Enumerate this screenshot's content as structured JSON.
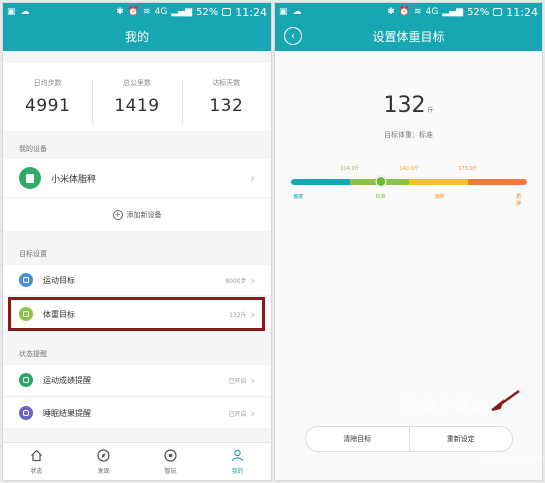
{
  "status_bar": {
    "battery": "52%",
    "time": "11:24",
    "network": "4G"
  },
  "left_screen": {
    "title": "我的",
    "stats": [
      {
        "label": "日均步数",
        "value": "4991"
      },
      {
        "label": "总公里数",
        "value": "1419"
      },
      {
        "label": "达标天数",
        "value": "132"
      }
    ],
    "devices_section": "我的设备",
    "device_name": "小米体脂秤",
    "add_device": "添加新设备",
    "goals_section": "目标设置",
    "goals": [
      {
        "label": "运动目标",
        "value": "8000步",
        "icon_color": "#4a90d9",
        "icon": "run-target-icon"
      },
      {
        "label": "体重目标",
        "value": "132斤",
        "icon_color": "#8bc34a",
        "icon": "scale-icon"
      }
    ],
    "reminders_section": "状态提醒",
    "reminders": [
      {
        "label": "运动成绩提醒",
        "value": "已开启",
        "icon_color": "#2aa66b",
        "icon": "footprints-icon"
      },
      {
        "label": "睡眠结果提醒",
        "value": "已开启",
        "icon_color": "#6a63c9",
        "icon": "moon-icon"
      }
    ],
    "tabs": [
      {
        "label": "状态",
        "icon": "home-icon",
        "active": false
      },
      {
        "label": "发现",
        "icon": "compass-icon",
        "active": false
      },
      {
        "label": "智玩",
        "icon": "target-icon",
        "active": false
      },
      {
        "label": "我的",
        "icon": "person-icon",
        "active": true
      }
    ]
  },
  "right_screen": {
    "title": "设置体重目标",
    "weight": "132",
    "unit": "斤",
    "status": "目标体重：标准",
    "scale_marks": [
      {
        "label": "114.0斤",
        "color": "#8bc34a",
        "at": 0.25
      },
      {
        "label": "140.0斤",
        "color": "#f5a623",
        "at": 0.5
      },
      {
        "label": "173.0斤",
        "color": "#f08a3c",
        "at": 0.75
      }
    ],
    "scale_zones": [
      {
        "label": "偏瘦",
        "color": "#17a7b2",
        "at": 0.03
      },
      {
        "label": "标准",
        "color": "#8bc34a",
        "at": 0.38
      },
      {
        "label": "偏胖",
        "color": "#f5a623",
        "at": 0.63
      },
      {
        "label": "肥胖",
        "color": "#f08a3c",
        "at": 0.97
      }
    ],
    "scale_colors": [
      "#17a7b2",
      "#8bc34a",
      "#f5c223",
      "#f07a3c"
    ],
    "knob_position": 0.38,
    "clear_button": "清除目标",
    "reset_button": "重新设定"
  },
  "watermark": "沃德下载站",
  "watermark_url": "www.wo386.com"
}
